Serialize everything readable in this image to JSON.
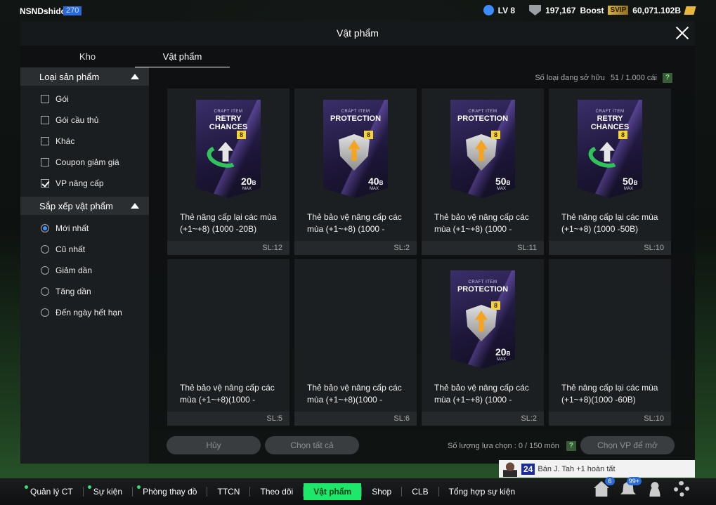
{
  "player": {
    "name": "NSNDshido",
    "level_badge": "270"
  },
  "resources": {
    "lv": "LV 8",
    "medals": "197,167",
    "boost_label": "Boost",
    "svip": "SVIP",
    "coins": "60,071.102B"
  },
  "window": {
    "title": "Vật phẩm"
  },
  "tabs": [
    {
      "label": "Kho"
    },
    {
      "label": "Vật phẩm"
    }
  ],
  "sidebar": {
    "type_header": "Loại sản phẩm",
    "type_options": [
      {
        "label": "Gói",
        "checked": false
      },
      {
        "label": "Gói cầu thủ",
        "checked": false
      },
      {
        "label": "Khác",
        "checked": false
      },
      {
        "label": "Coupon giảm giá",
        "checked": false
      },
      {
        "label": "VP nâng cấp",
        "checked": true
      }
    ],
    "sort_header": "Sắp xếp vật phẩm",
    "sort_options": [
      {
        "label": "Mới nhất",
        "selected": true
      },
      {
        "label": "Cũ nhất",
        "selected": false
      },
      {
        "label": "Giảm dần",
        "selected": false
      },
      {
        "label": "Tăng dần",
        "selected": false
      },
      {
        "label": "Đến ngày hết hạn",
        "selected": false
      }
    ]
  },
  "owned": {
    "label": "Số loại đang sở hữu",
    "value": "51 / 1.000 cái",
    "help": "?"
  },
  "items": [
    {
      "art": "retry",
      "craft": "CRAFT ITEM",
      "title": "RETRY CHANCES",
      "level": "8",
      "grade": "20",
      "unit": "B",
      "max": "MAX",
      "name": "Thẻ nâng cấp lại các mùa (+1~+8) (1000 -20B)",
      "qty": "SL:12"
    },
    {
      "art": "protect",
      "craft": "CRAFT ITEM",
      "title": "PROTECTION",
      "level": "8",
      "grade": "40",
      "unit": "B",
      "max": "MAX",
      "name": "Thẻ bảo vệ nâng cấp các mùa (+1~+8) (1000 -",
      "qty": "SL:2"
    },
    {
      "art": "protect",
      "craft": "CRAFT ITEM",
      "title": "PROTECTION",
      "level": "8",
      "grade": "50",
      "unit": "B",
      "max": "MAX",
      "name": "Thẻ bảo vệ nâng cấp các mùa (+1~+8) (1000 -",
      "qty": "SL:11"
    },
    {
      "art": "retry",
      "craft": "CRAFT ITEM",
      "title": "RETRY CHANCES",
      "level": "8",
      "grade": "50",
      "unit": "B",
      "max": "MAX",
      "name": "Thẻ nâng cấp lại các mùa (+1~+8) (1000 -50B)",
      "qty": "SL:10"
    },
    {
      "art": "none",
      "name": "Thẻ bảo vệ nâng cấp các mùa (+1~+8)(1000 -",
      "qty": "SL:5"
    },
    {
      "art": "none",
      "name": "Thẻ bảo vệ nâng cấp các mùa (+1~+8)(1000 -",
      "qty": "SL:6"
    },
    {
      "art": "protect",
      "craft": "CRAFT ITEM",
      "title": "PROTECTION",
      "level": "8",
      "grade": "20",
      "unit": "B",
      "max": "MAX",
      "name": "Thẻ bảo vệ nâng cấp các mùa (+1~+8) (1000 -",
      "qty": "SL:2"
    },
    {
      "art": "none",
      "name": "Thẻ nâng cấp lại các mùa (+1~+8)(1000 -60B)",
      "qty": "SL:10"
    }
  ],
  "actions": {
    "cancel": "Hủy",
    "select_all": "Chọn tất cả",
    "selected_label": "Số lượng lựa chọn : 0 / 150 món",
    "help": "?",
    "open": "Chọn VP để mở"
  },
  "toast": {
    "number": "24",
    "text": "Bán J. Tah +1 hoàn tất"
  },
  "nav": [
    {
      "label": "Quản lý CT",
      "dot": true
    },
    {
      "label": "Sự kiện",
      "dot": true
    },
    {
      "label": "Phòng thay đồ",
      "dot": true
    },
    {
      "label": "TTCN",
      "dot": false
    },
    {
      "label": "Theo dõi",
      "dot": false
    },
    {
      "label": "Vật phẩm",
      "dot": false,
      "active": true
    },
    {
      "label": "Shop",
      "dot": false
    },
    {
      "label": "CLB",
      "dot": false
    },
    {
      "label": "Tổng hợp sự kiện",
      "dot": false
    }
  ],
  "nav_icons": [
    {
      "name": "home-icon",
      "badge": "6"
    },
    {
      "name": "bell-icon",
      "badge": "99+"
    },
    {
      "name": "profile-icon",
      "badge": ""
    },
    {
      "name": "settings-icon",
      "badge": ""
    }
  ]
}
